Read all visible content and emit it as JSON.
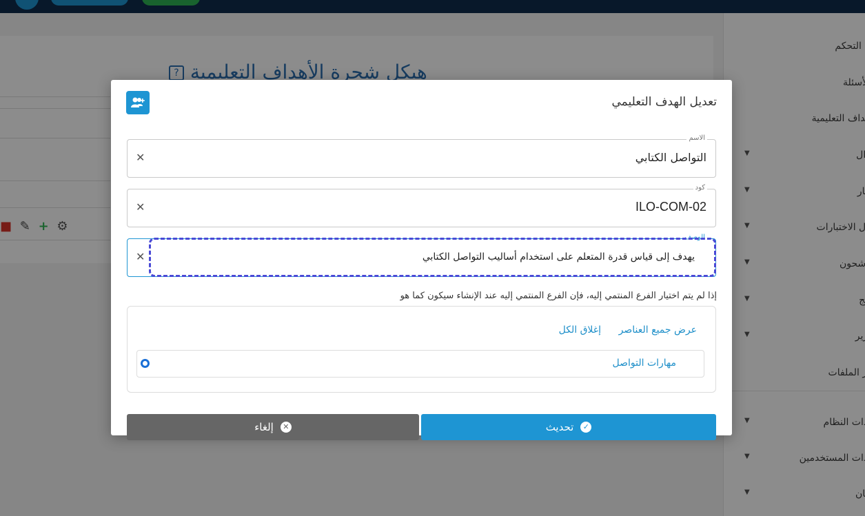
{
  "sidebar": {
    "items": [
      {
        "label": "م التحكم",
        "caret": false
      },
      {
        "label": "الأسئلة",
        "caret": false
      },
      {
        "label": "هداف التعليمية",
        "caret": false
      },
      {
        "label": "ؤال",
        "caret": true
      },
      {
        "label": "تبار",
        "caret": true
      },
      {
        "label": "ول الاختبارات",
        "caret": true
      },
      {
        "label": "رشحون",
        "caret": true
      },
      {
        "label": "ائج",
        "caret": true
      },
      {
        "label": "ارير",
        "caret": true
      },
      {
        "label": "ير الملفات",
        "caret": false
      },
      {
        "label": "ادات النظام",
        "caret": true
      },
      {
        "label": "ادات المستخدمين",
        "caret": true
      },
      {
        "label": "مان",
        "caret": true
      }
    ]
  },
  "background": {
    "page_title": "هيكل شجرة الأهداف التعليمية"
  },
  "modal": {
    "title": "تعديل الهدف التعليمي",
    "fields": {
      "name": {
        "label": "الاسم",
        "value": "التواصل الكتابي"
      },
      "code": {
        "label": "كود",
        "value": "ILO-COM-02"
      },
      "description": {
        "label": "الوصف",
        "value": "يهدف إلى قياس قدرة المتعلم على استخدام أساليب التواصل الكتابي"
      }
    },
    "note": "إذا لم يتم اختيار الفرع المنتمي إليه، فإن الفرع المنتمي إليه عند الإنشاء سيكون كما هو",
    "tree": {
      "expand_all": "عرض جميع العناصر",
      "collapse_all": "إغلاق الكل",
      "node_label": "مهارات التواصل",
      "node_selected": true
    },
    "buttons": {
      "update": "تحديث",
      "cancel": "إلغاء"
    }
  },
  "colors": {
    "primary": "#1e95d3",
    "navbar": "#0f2d4d",
    "cancel": "#666666",
    "focus_ring": "#4a4ad6"
  }
}
